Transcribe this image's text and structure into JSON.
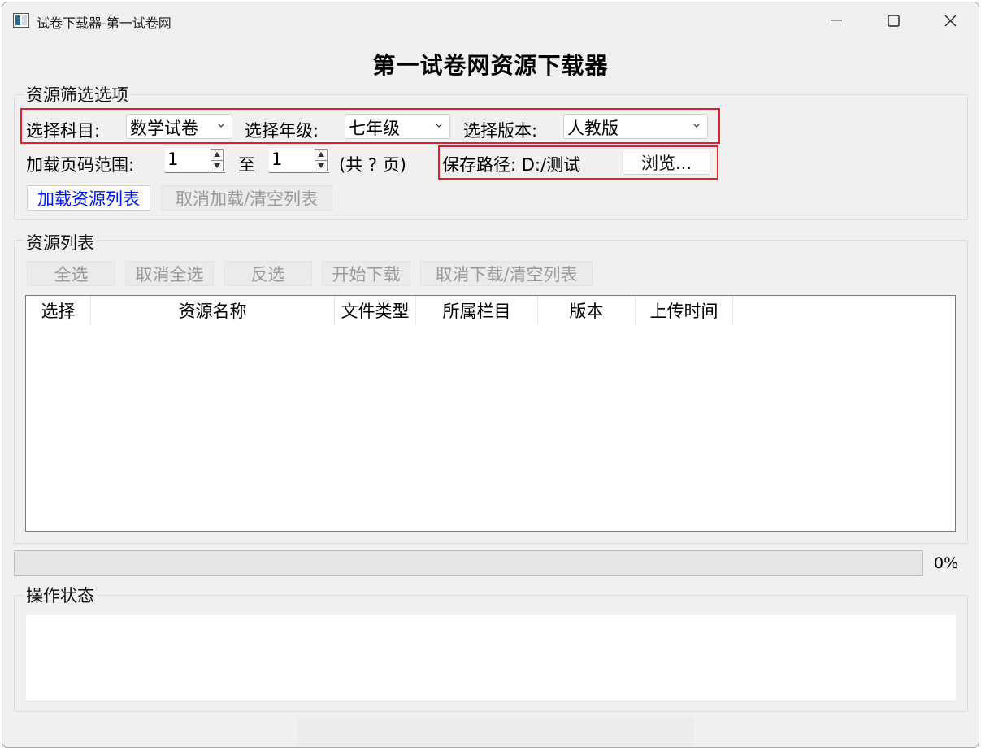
{
  "window": {
    "title": "试卷下载器-第一试卷网"
  },
  "heading": "第一试卷网资源下载器",
  "filter": {
    "group_title": "资源筛选选项",
    "subject_label": "选择科目:",
    "subject_value": "数学试卷",
    "grade_label": "选择年级:",
    "grade_value": "七年级",
    "edition_label": "选择版本:",
    "edition_value": "人教版",
    "page_range_label": "加载页码范围:",
    "page_from": "1",
    "to_label": "至",
    "page_to": "1",
    "total_label": "(共 ? 页)",
    "save_path_label": "保存路径: D:/测试",
    "browse_label": "浏览...",
    "load_button": "加载资源列表",
    "cancel_load_button": "取消加载/清空列表"
  },
  "resources": {
    "group_title": "资源列表",
    "select_all": "全选",
    "deselect_all": "取消全选",
    "invert": "反选",
    "start_download": "开始下载",
    "cancel_download": "取消下载/清空列表",
    "columns": [
      "选择",
      "资源名称",
      "文件类型",
      "所属栏目",
      "版本",
      "上传时间"
    ],
    "rows": []
  },
  "progress": {
    "value": 0,
    "label": "0%"
  },
  "status": {
    "group_title": "操作状态",
    "text": ""
  },
  "colors": {
    "highlight_box": "#e0202c",
    "link_blue": "#0018e8"
  }
}
